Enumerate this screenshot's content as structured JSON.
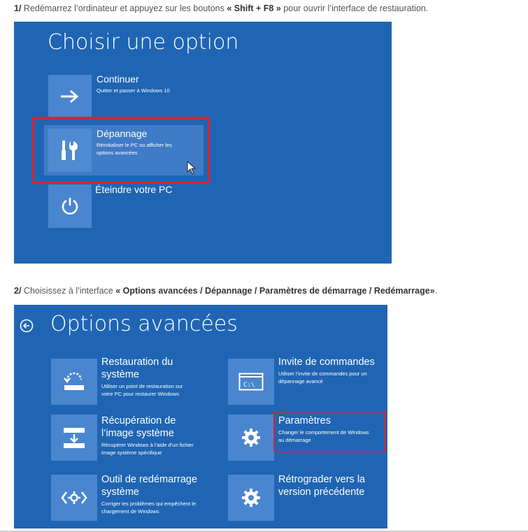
{
  "step1": {
    "number": "1/",
    "text_before": " Redémarrez l’ordinateur et appuyez sur les boutons ",
    "keys": "« Shift + F8 »",
    "text_after": " pour ouvrir l’interface de restauration."
  },
  "screen1": {
    "title": "Choisir une option",
    "options": [
      {
        "icon": "arrow-right-icon",
        "title": "Continuer",
        "desc": [
          "Quitter et passer à Windows 10"
        ]
      },
      {
        "icon": "tools-icon",
        "title": "Dépannage",
        "desc": [
          "Réinitialiser le PC ou afficher les",
          "options avancées"
        ]
      },
      {
        "icon": "power-icon",
        "title": "Éteindre votre PC",
        "desc": []
      }
    ]
  },
  "step2": {
    "number": "2/",
    "text_before": " Choisissez à l’interface ",
    "path": "« Options avancées / Dépannage / Paramètres de démarrage / Redémarrage»",
    "text_after": "."
  },
  "screen2": {
    "title": "Options avancées",
    "options": [
      {
        "icon": "system-restore-icon",
        "title": [
          "Restauration du",
          "système"
        ],
        "desc": [
          "Utiliser un point de restauration sur",
          "votre PC pour restaurer Windows"
        ]
      },
      {
        "icon": "command-prompt-icon",
        "title": [
          "Invite de commandes"
        ],
        "desc": [
          "Utiliser l’invite de commandes pour un",
          "dépannage avancé"
        ]
      },
      {
        "icon": "image-recovery-icon",
        "title": [
          "Récupération de",
          "l’image système"
        ],
        "desc": [
          "Récupérer Windows à l’aide d’un fichier",
          "image système spécifique"
        ]
      },
      {
        "icon": "gear-icon",
        "title": [
          "Paramètres"
        ],
        "desc": [
          "Changer le comportement de Windows",
          "au démarrage"
        ]
      },
      {
        "icon": "startup-repair-icon",
        "title": [
          "Outil de redémarrage",
          "système"
        ],
        "desc": [
          "Corriger les problèmes qui empêchent le",
          "chargement de Windows"
        ]
      },
      {
        "icon": "gear-icon",
        "title": [
          "Rétrograder vers la",
          "version précédente"
        ],
        "desc": []
      }
    ],
    "cmd_label": "C:\\"
  },
  "colors": {
    "screen_bg": "#1f65b3",
    "tile_bg": "#4a86cf",
    "highlight": "#e0212b"
  }
}
